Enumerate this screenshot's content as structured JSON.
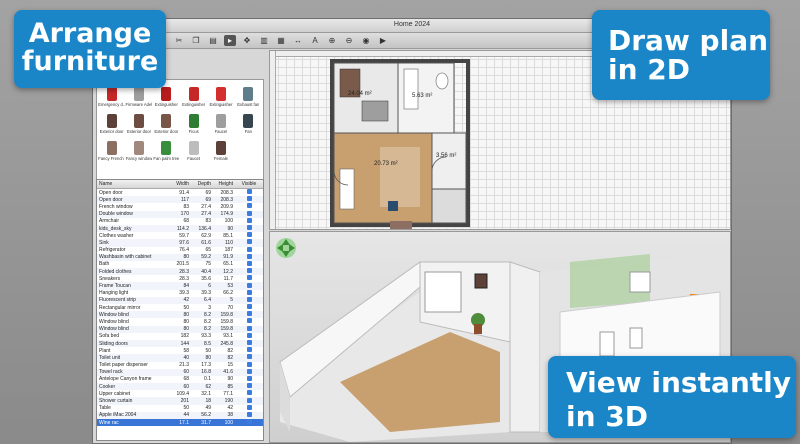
{
  "window": {
    "title": "Home 2024"
  },
  "toolbar": {
    "icons": [
      "cut-icon",
      "copy-icon",
      "paste-icon",
      "select-icon",
      "pan-icon",
      "wall-icon",
      "room-icon",
      "dimension-icon",
      "text-icon",
      "zoom-in-icon",
      "zoom-out-icon",
      "photo-icon",
      "video-icon"
    ]
  },
  "catalog": {
    "items": [
      {
        "label": "Emergency d...",
        "color": "#c62828"
      },
      {
        "label": "Firmware Adel...",
        "color": "#9e9e9e"
      },
      {
        "label": "Extinguisher",
        "color": "#b71c1c"
      },
      {
        "label": "Extinguisher",
        "color": "#c62828"
      },
      {
        "label": "Extinguisher",
        "color": "#d32f2f"
      },
      {
        "label": "Exhaust fan",
        "color": "#607d8b"
      },
      {
        "label": "Exterior door",
        "color": "#5d4037"
      },
      {
        "label": "Exterior door",
        "color": "#6d4c41"
      },
      {
        "label": "Exterior door",
        "color": "#795548"
      },
      {
        "label": "Ficus",
        "color": "#2e7d32"
      },
      {
        "label": "Faucet",
        "color": "#9e9e9e"
      },
      {
        "label": "Fan",
        "color": "#37474f"
      },
      {
        "label": "Fancy French d...",
        "color": "#8d6e63"
      },
      {
        "label": "Fancy window",
        "color": "#a1887f"
      },
      {
        "label": "Fan palm tree",
        "color": "#388e3c"
      },
      {
        "label": "Faucet",
        "color": "#bdbdbd"
      },
      {
        "label": "Female",
        "color": "#5d4037"
      },
      {
        "label": "",
        "color": "#ffffff"
      }
    ]
  },
  "furniture_table": {
    "headers": {
      "name": "Name",
      "width": "Width",
      "depth": "Depth",
      "height": "Height",
      "visible": "Visible"
    },
    "rows": [
      {
        "name": "Open door",
        "width": "91.4",
        "depth": "69",
        "height": "208.3"
      },
      {
        "name": "Open door",
        "width": "117",
        "depth": "69",
        "height": "208.3"
      },
      {
        "name": "French window",
        "width": "83",
        "depth": "27.4",
        "height": "209.9"
      },
      {
        "name": "Double window",
        "width": "170",
        "depth": "27.4",
        "height": "174.9"
      },
      {
        "name": "Armchair",
        "width": "68",
        "depth": "83",
        "height": "100"
      },
      {
        "name": "kids_desk_sky",
        "width": "114.2",
        "depth": "136.4",
        "height": "90"
      },
      {
        "name": "Clothes washer",
        "width": "59.7",
        "depth": "62.9",
        "height": "85.1"
      },
      {
        "name": "Sink",
        "width": "97.6",
        "depth": "61.6",
        "height": "110"
      },
      {
        "name": "Refrigerator",
        "width": "76.4",
        "depth": "65",
        "height": "187"
      },
      {
        "name": "Washbasin with cabinet",
        "width": "80",
        "depth": "59.2",
        "height": "91.9"
      },
      {
        "name": "Bath",
        "width": "201.5",
        "depth": "75",
        "height": "65.1"
      },
      {
        "name": "Folded clothes",
        "width": "28.3",
        "depth": "40.4",
        "height": "12.2"
      },
      {
        "name": "Sneakers",
        "width": "28.3",
        "depth": "35.6",
        "height": "11.7"
      },
      {
        "name": "Frame Toucan",
        "width": "84",
        "depth": "6",
        "height": "53"
      },
      {
        "name": "Hanging light",
        "width": "39.3",
        "depth": "39.3",
        "height": "66.2"
      },
      {
        "name": "Fluorescent strip",
        "width": "42",
        "depth": "6.4",
        "height": "5"
      },
      {
        "name": "Rectangular mirror",
        "width": "50",
        "depth": "3",
        "height": "70"
      },
      {
        "name": "Window blind",
        "width": "80",
        "depth": "8.2",
        "height": "159.8"
      },
      {
        "name": "Window blind",
        "width": "80",
        "depth": "8.2",
        "height": "159.8"
      },
      {
        "name": "Window blind",
        "width": "80",
        "depth": "8.2",
        "height": "159.8"
      },
      {
        "name": "Sofa bed",
        "width": "182",
        "depth": "93.3",
        "height": "93.1"
      },
      {
        "name": "Sliding doors",
        "width": "144",
        "depth": "8.5",
        "height": "245.8"
      },
      {
        "name": "Plant",
        "width": "58",
        "depth": "50",
        "height": "82"
      },
      {
        "name": "Toilet unit",
        "width": "40",
        "depth": "80",
        "height": "82"
      },
      {
        "name": "Toilet paper dispenser",
        "width": "21.3",
        "depth": "17.3",
        "height": "15"
      },
      {
        "name": "Towel rack",
        "width": "60",
        "depth": "16.8",
        "height": "41.6"
      },
      {
        "name": "Antelope Canyon frame",
        "width": "68",
        "depth": "0.1",
        "height": "90"
      },
      {
        "name": "Cooker",
        "width": "60",
        "depth": "62",
        "height": "85"
      },
      {
        "name": "Upper cabinet",
        "width": "109.4",
        "depth": "32.1",
        "height": "77.1"
      },
      {
        "name": "Shower curtain",
        "width": "201",
        "depth": "18",
        "height": "190"
      },
      {
        "name": "Table",
        "width": "50",
        "depth": "49",
        "height": "42"
      },
      {
        "name": "Apple iMac 2004",
        "width": "44",
        "depth": "56.2",
        "height": "38"
      },
      {
        "name": "Wine rac",
        "width": "17.1",
        "depth": "31.7",
        "height": "100",
        "selected": true
      }
    ]
  },
  "plan": {
    "rooms": [
      {
        "area": "24.04 m²"
      },
      {
        "area": "5.63 m²"
      },
      {
        "area": "20.73 m²"
      },
      {
        "area": "3.56 m²"
      }
    ]
  },
  "callouts": {
    "arrange_line1": "Arrange",
    "arrange_line2": "furniture",
    "plan_line1": "Draw plan",
    "plan_line2": "in 2D",
    "view_line1": "View instantly",
    "view_line2": "in 3D"
  },
  "colors": {
    "callout_bg": "#1a86c7",
    "selection": "#3875d7",
    "wood_floor": "#c8a070",
    "wall": "#555555"
  }
}
